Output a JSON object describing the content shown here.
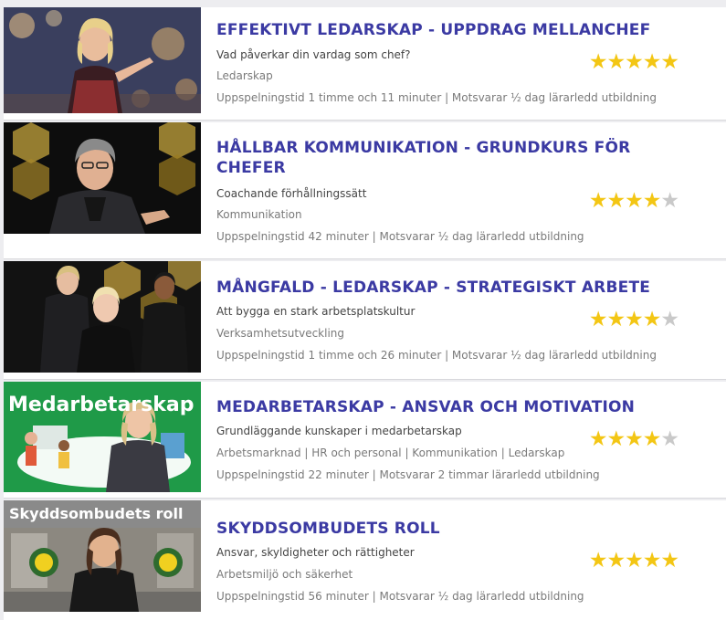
{
  "courses": [
    {
      "title": "EFFEKTIVT LEDARSKAP - UPPDRAG MELLANCHEF",
      "subtitle": "Vad påverkar din vardag som chef?",
      "categories": "Ledarskap",
      "meta": "Uppspelningstid 1 timme och 11 minuter | Motsvarar ½ dag lärarledd utbildning",
      "rating": 5,
      "stars_total": 5
    },
    {
      "title": "HÅLLBAR KOMMUNIKATION - GRUNDKURS FÖR CHEFER",
      "subtitle": "Coachande förhållningssätt",
      "categories": "Kommunikation",
      "meta": "Uppspelningstid 42 minuter | Motsvarar ½ dag lärarledd utbildning",
      "rating": 4,
      "stars_total": 5
    },
    {
      "title": "MÅNGFALD - LEDARSKAP - STRATEGISKT ARBETE",
      "subtitle": "Att bygga en stark arbetsplatskultur",
      "categories": "Verksamhetsutveckling",
      "meta": "Uppspelningstid 1 timme och 26 minuter | Motsvarar ½ dag lärarledd utbildning",
      "rating": 4,
      "stars_total": 5
    },
    {
      "title": "MEDARBETARSKAP - ANSVAR OCH MOTIVATION",
      "subtitle": "Grundläggande kunskaper i medarbetarskap",
      "categories": "Arbetsmarknad | HR och personal | Kommunikation | Ledarskap",
      "meta": "Uppspelningstid 22 minuter | Motsvarar 2 timmar lärarledd utbildning",
      "rating": 4,
      "stars_total": 5,
      "thumb_text": "Medarbetarskap"
    },
    {
      "title": "SKYDDSOMBUDETS ROLL",
      "subtitle": "Ansvar, skyldigheter och rättigheter",
      "categories": "Arbetsmiljö och säkerhet",
      "meta": "Uppspelningstid 56 minuter | Motsvarar ½ dag lärarledd utbildning",
      "rating": 5,
      "stars_total": 5,
      "thumb_text": "Skyddsombudets roll"
    }
  ],
  "colors": {
    "title": "#3b3aa3",
    "star_on": "#f3c614",
    "star_off": "#c9c9c9"
  },
  "icons": [
    "star-icon"
  ]
}
